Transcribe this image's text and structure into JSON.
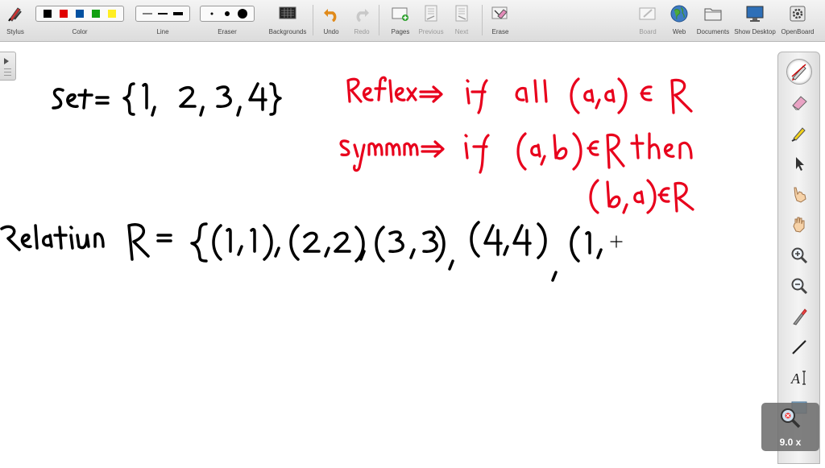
{
  "toolbar": {
    "stylus": "Stylus",
    "color": "Color",
    "line": "Line",
    "eraser": "Eraser",
    "backgrounds": "Backgrounds",
    "undo": "Undo",
    "redo": "Redo",
    "pages": "Pages",
    "previous": "Previous",
    "next": "Next",
    "erase": "Erase",
    "board": "Board",
    "web": "Web",
    "documents": "Documents",
    "show_desktop": "Show Desktop",
    "openboard": "OpenBoard"
  },
  "colors": {
    "swatches": [
      "#000000",
      "#e00000",
      "#0050a0",
      "#11a011",
      "#ffee22"
    ],
    "black_ink": "#000000",
    "red_ink": "#e8001c"
  },
  "icons": {
    "stylus": "stylus-icon",
    "backgrounds": "backgrounds-icon",
    "undo": "undo-icon",
    "redo": "redo-icon",
    "pages": "add-page-icon",
    "previous": "previous-page-icon",
    "next": "next-page-icon",
    "erase": "erase-page-icon",
    "board": "board-icon",
    "web": "globe-icon",
    "documents": "folder-icon",
    "show_desktop": "monitor-icon",
    "openboard": "gear-icon"
  },
  "side_tools": [
    "pen-tool-icon",
    "eraser-tool-icon",
    "marker-tool-icon",
    "selector-tool-icon",
    "interact-hand-icon",
    "move-hand-icon",
    "zoom-in-icon",
    "zoom-out-icon",
    "laser-pointer-icon",
    "line-tool-icon",
    "text-tool-icon",
    "capture-icon"
  ],
  "zoom": {
    "label": "9.0 x"
  },
  "handwriting": {
    "set_line": "Set = {1, 2, 3, 4}",
    "reflex_line": "Reflex → if all (a,a) ∈ R",
    "symm_line_1": "Symm → if (a,b) ∈ R then",
    "symm_line_2": "(b,a) ∈ R",
    "relation_line": "Relation R = {(1,1), (2,2), (3,3), (4,4), (1,"
  }
}
